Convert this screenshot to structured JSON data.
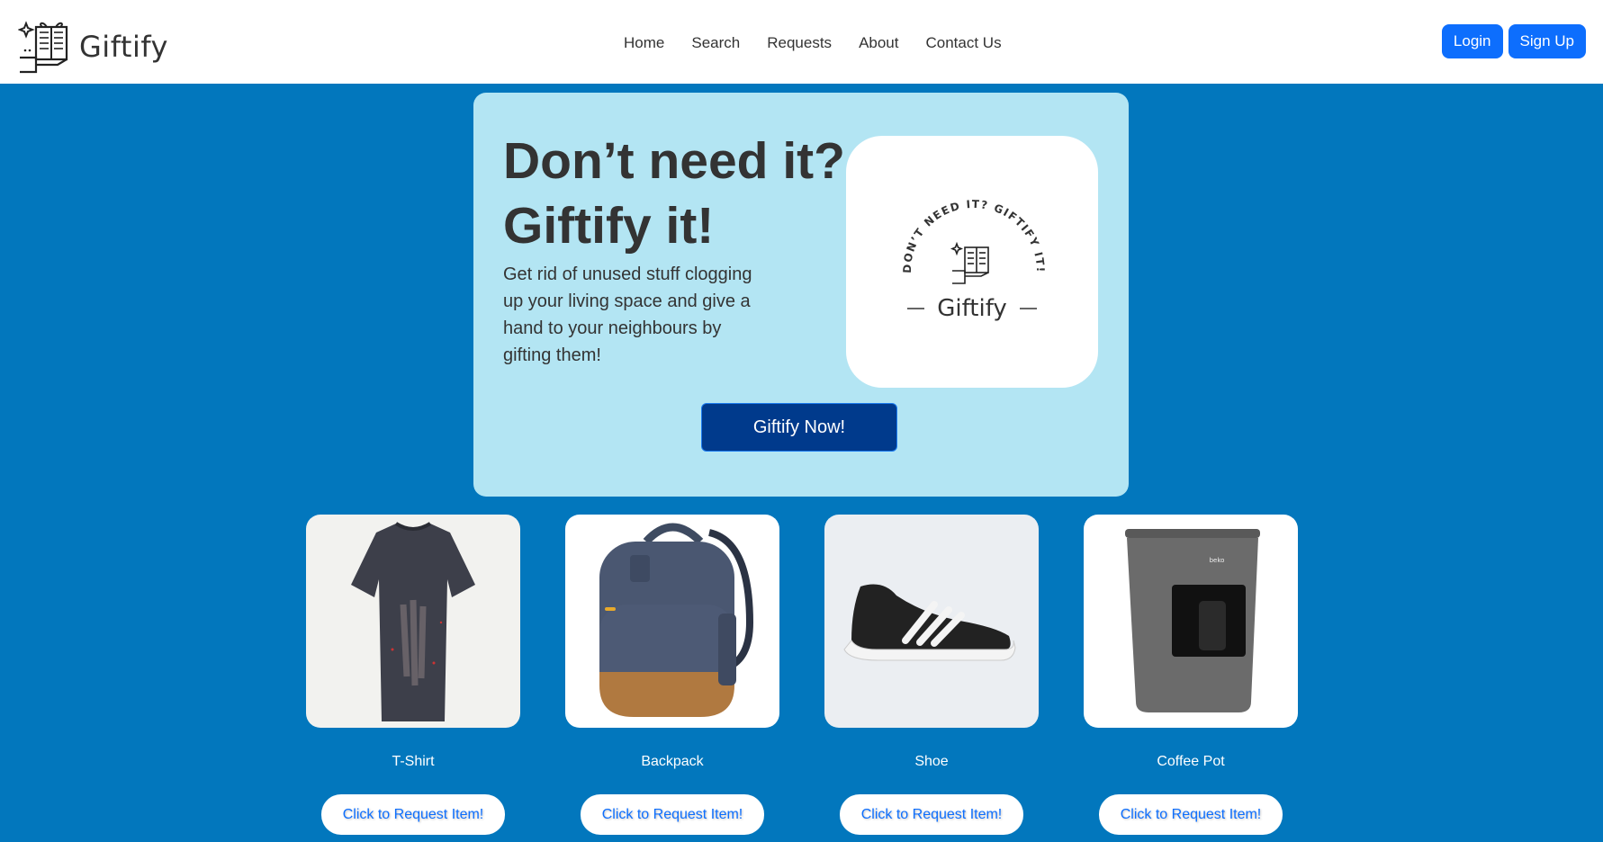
{
  "brand": {
    "name": "Giftify"
  },
  "nav": {
    "items": [
      "Home",
      "Search",
      "Requests",
      "About",
      "Contact Us"
    ]
  },
  "auth": {
    "login": "Login",
    "signup": "Sign Up"
  },
  "hero": {
    "title": "Don’t need it? Giftify it!",
    "subtitle": "Get rid of unused stuff clogging up your living space and give a hand to your neighbours by gifting them!",
    "cta": "Giftify Now!",
    "badge_tagline": "DON’T NEED IT? GIFTIFY IT!",
    "badge_brand": "Giftify"
  },
  "items": [
    {
      "name": "T-Shirt",
      "button": "Click to Request Item!",
      "icon": "tshirt-image",
      "product_mark": ""
    },
    {
      "name": "Backpack",
      "button": "Click to Request Item!",
      "icon": "backpack-image",
      "product_mark": ""
    },
    {
      "name": "Shoe",
      "button": "Click to Request Item!",
      "icon": "shoe-image",
      "product_mark": ""
    },
    {
      "name": "Coffee Pot",
      "button": "Click to Request Item!",
      "icon": "coffee-pot-image",
      "product_mark": "beko"
    }
  ],
  "colors": {
    "page_bg": "#0277bd",
    "hero_bg": "#b3e5f3",
    "cta_bg": "#003a8c",
    "accent": "#0d6efd"
  }
}
